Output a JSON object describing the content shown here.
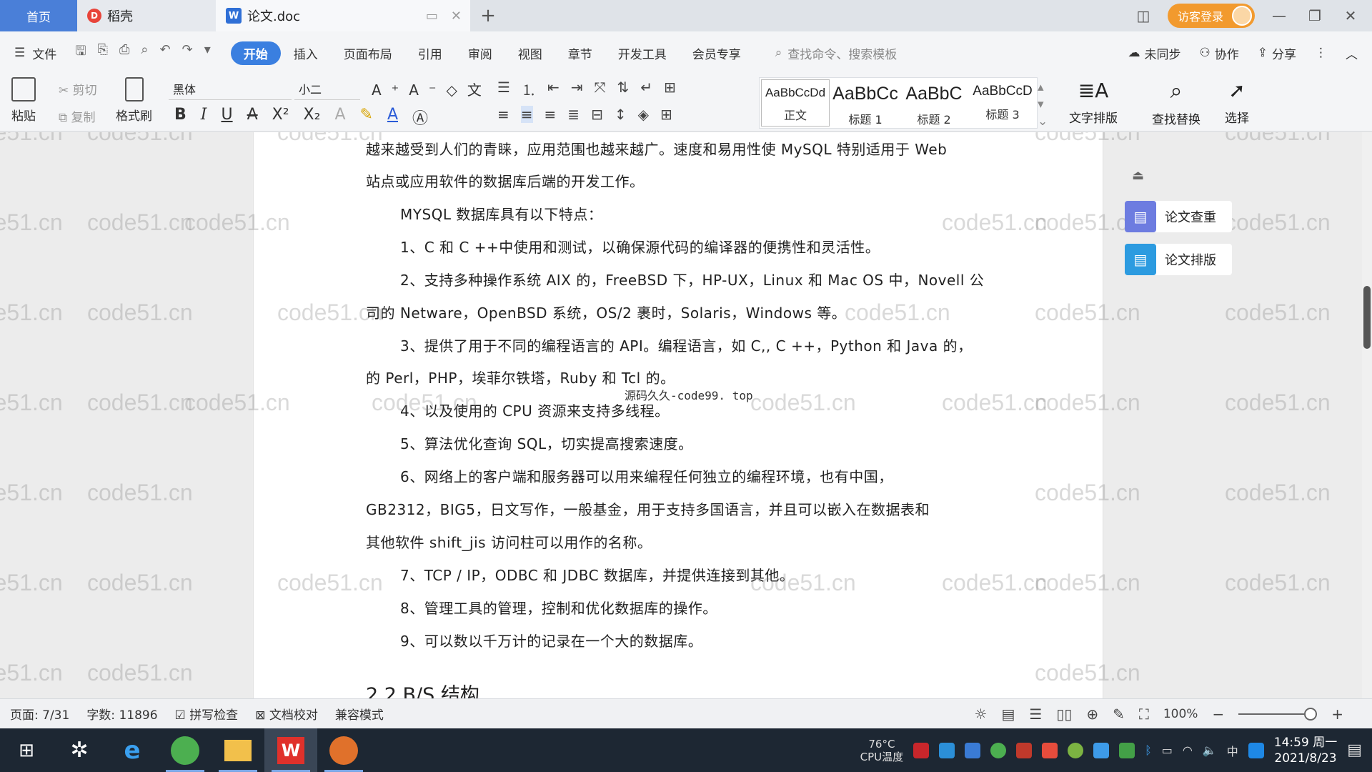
{
  "tabs": {
    "home": "首页",
    "daoke": "稻壳",
    "doc": "论文.doc",
    "new_tab": "+"
  },
  "account": {
    "login": "访客登录"
  },
  "menu": {
    "file": "文件",
    "items": [
      "开始",
      "插入",
      "页面布局",
      "引用",
      "审阅",
      "视图",
      "章节",
      "开发工具",
      "会员专享"
    ],
    "search_placeholder": "查找命令、搜索模板",
    "right": [
      "未同步",
      "协作",
      "分享"
    ]
  },
  "ribbon": {
    "paste": "粘贴",
    "cut": "剪切",
    "copy": "复制",
    "format_painter": "格式刷",
    "font": "黑体",
    "size": "小二",
    "styles": [
      {
        "sample": "AaBbCcDd",
        "label": "正文"
      },
      {
        "sample": "AaBbCc",
        "label": "标题 1"
      },
      {
        "sample": "AaBbC",
        "label": "标题 2"
      },
      {
        "sample": "AaBbCcD",
        "label": "标题 3"
      }
    ],
    "text_layout": "文字排版",
    "find_replace": "查找替换",
    "select": "选择"
  },
  "document": {
    "lines": [
      {
        "text": "越来越受到人们的青睐，应用范围也越来越广。速度和易用性使 MySQL 特别适用于 Web",
        "indent": false
      },
      {
        "text": "站点或应用软件的数据库后端的开发工作。",
        "indent": false
      },
      {
        "text": "MYSQL 数据库具有以下特点：",
        "indent": true
      },
      {
        "text": "1、C 和 C ++中使用和测试，以确保源代码的编译器的便携性和灵活性。",
        "indent": true
      },
      {
        "text": "2、支持多种操作系统 AIX 的，FreeBSD 下，HP-UX，Linux 和 Mac OS 中，Novell 公",
        "indent": true
      },
      {
        "text": "司的 Netware，OpenBSD 系统，OS/2 裹时，Solaris，Windows 等。",
        "indent": false
      },
      {
        "text": "3、提供了用于不同的编程语言的 API。编程语言，如 C,, C ++，Python 和 Java 的，",
        "indent": true
      },
      {
        "text": "的 Perl，PHP，埃菲尔铁塔，Ruby 和 Tcl 的。",
        "indent": false
      },
      {
        "text": "4、以及使用的 CPU 资源来支持多线程。",
        "indent": true
      },
      {
        "text": "5、算法优化查询 SQL，切实提高搜索速度。",
        "indent": true
      },
      {
        "text": "6、网络上的客户端和服务器可以用来编程任何独立的编程环境，也有中国，",
        "indent": true
      },
      {
        "text": "GB2312，BIG5，日文写作，一般基金，用于支持多国语言，并且可以嵌入在数据表和",
        "indent": false
      },
      {
        "text": "其他软件 shift_jis 访问柱可以用作的名称。",
        "indent": false
      },
      {
        "text": "7、TCP / IP，ODBC 和 JDBC 数据库，并提供连接到其他。",
        "indent": true
      },
      {
        "text": "8、管理工具的管理，控制和优化数据库的操作。",
        "indent": true
      },
      {
        "text": "9、可以数以千万计的记录在一个大的数据库。",
        "indent": true
      }
    ],
    "heading": "2.2 B/S 结构",
    "overlay_note": "源码久久-code99. top"
  },
  "watermark": "code51.cn",
  "side_panel": {
    "check": "论文查重",
    "format": "论文排版"
  },
  "status": {
    "page": "页面: 7/31",
    "words": "字数: 11896",
    "spell": "拼写检查",
    "proof": "文档校对",
    "compat": "兼容模式",
    "zoom": "100%"
  },
  "taskbar": {
    "cpu_temp": "76°C",
    "cpu_label": "CPU温度",
    "ime": "中",
    "time": "14:59 周一",
    "date": "2021/8/23"
  }
}
